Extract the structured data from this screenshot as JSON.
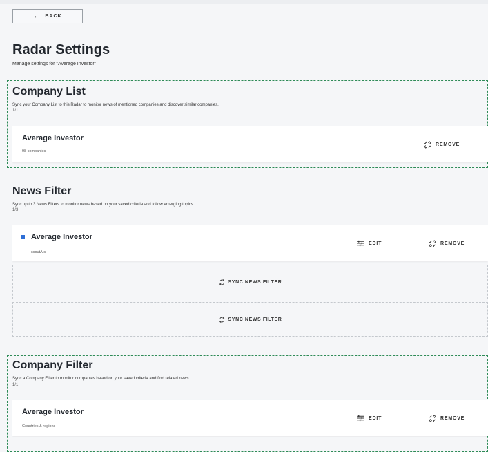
{
  "back": {
    "label": "BACK"
  },
  "header": {
    "title": "Radar Settings",
    "subtitle": "Manage settings for \"Average Investor\""
  },
  "company_list": {
    "title": "Company List",
    "description": "Sync your Company List to this Radar to monitor news of mentioned companies and discover similar companies.",
    "count": "1/1",
    "card": {
      "title": "Average Investor",
      "subtitle": "98 companies",
      "remove_label": "REMOVE"
    }
  },
  "news_filter": {
    "title": "News Filter",
    "description": "Sync up to 3 News Filters to monitor news based on your saved criteria and follow emerging topics.",
    "count": "1/3",
    "card": {
      "title": "Average Investor",
      "subtitle": "scoutAIs",
      "edit_label": "EDIT",
      "remove_label": "REMOVE"
    },
    "sync_slots": [
      "SYNC NEWS FILTER",
      "SYNC NEWS FILTER"
    ]
  },
  "company_filter": {
    "title": "Company Filter",
    "description": "Sync a Company Filter to monitor companies based on your saved criteria and find related news.",
    "count": "1/1",
    "card": {
      "title": "Average Investor",
      "subtitle": "Countries & regions",
      "edit_label": "EDIT",
      "remove_label": "REMOVE"
    }
  },
  "colors": {
    "accent_green": "#2e8b57",
    "news_filter_marker": "#2f6fd6",
    "background": "#f5f6f8"
  },
  "icons": [
    "arrow-left-icon",
    "unlink-icon",
    "sliders-icon",
    "sync-icon",
    "square-marker-icon"
  ]
}
